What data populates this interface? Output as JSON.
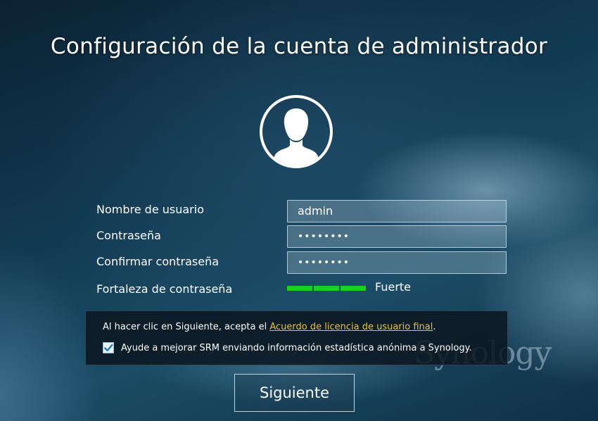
{
  "title": "Configuración de la cuenta de administrador",
  "avatar": {
    "icon": "user-avatar-icon"
  },
  "form": {
    "username_label": "Nombre de usuario",
    "username_value": "admin",
    "password_label": "Contraseña",
    "password_value": "••••••••",
    "confirm_label": "Confirmar contraseña",
    "confirm_value": "••••••••",
    "strength_label": "Fortaleza de contraseña",
    "strength_value": "Fuerte",
    "strength_level": 1.0,
    "strength_color": "#17d220"
  },
  "notice": {
    "text_before": "Al hacer clic en Siguiente, acepta el ",
    "link": "Acuerdo de licencia de usuario final",
    "text_after": ".",
    "link_color": "#e8c231",
    "checkbox_label": "Ayude a mejorar SRM enviando información estadística anónima a Synology.",
    "checkbox_checked": true
  },
  "watermark": "Synology",
  "next_button": "Siguiente"
}
